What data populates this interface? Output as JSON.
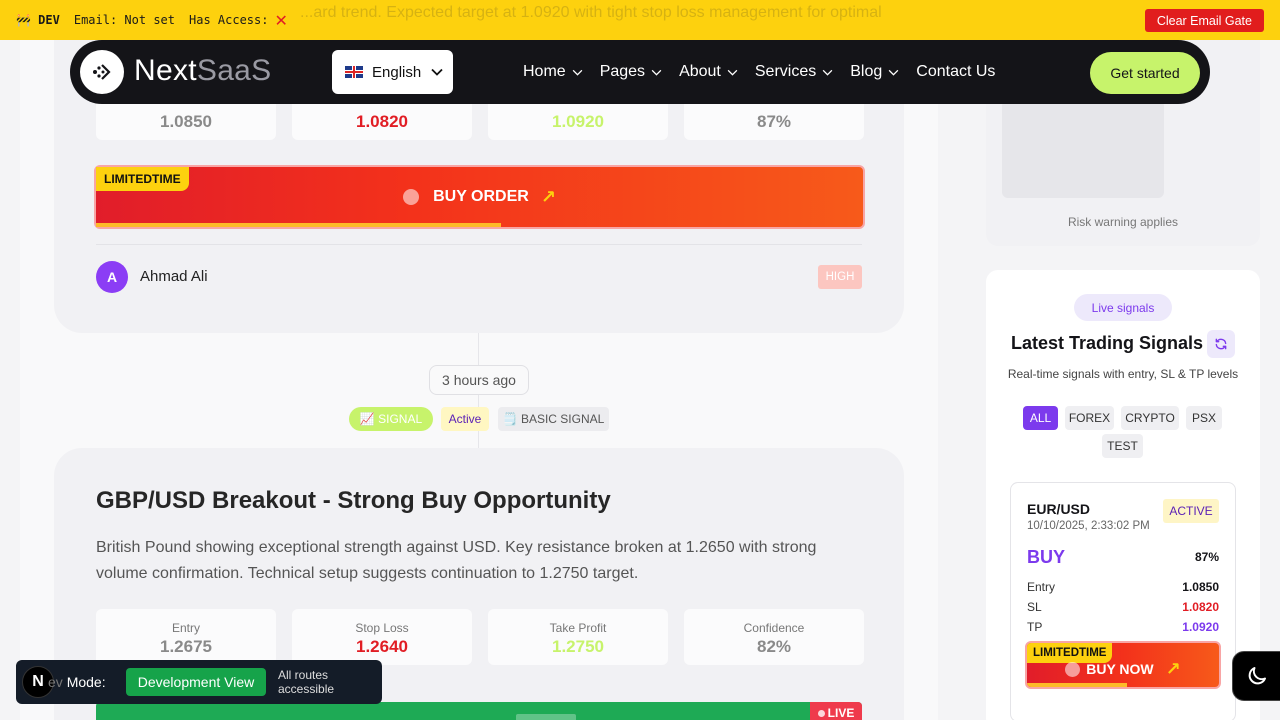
{
  "dev_banner": {
    "tag": "🚧 DEV",
    "email": "Email: Not set",
    "access": "Has Access:",
    "access_icon": "✕",
    "ghost_text": "...ard trend. Expected target at 1.0920 with tight stop loss management for optimal",
    "clear_button": "Clear Email Gate"
  },
  "nav": {
    "logo_main": "Next",
    "logo_accent": "SaaS",
    "language": "English",
    "links": [
      "Home",
      "Pages",
      "About",
      "Services",
      "Blog",
      "Contact Us"
    ],
    "cta": "Get started"
  },
  "card1": {
    "stats": [
      {
        "value": "1.0850",
        "color": "#8a8a8a"
      },
      {
        "value": "1.0820",
        "color": "#e11d24"
      },
      {
        "value": "1.0920",
        "color": "#c7f36b"
      },
      {
        "value": "87%",
        "color": "#8a8a8a"
      }
    ],
    "badge": "LIMITEDTIME",
    "button": "BUY ORDER",
    "author_initial": "A",
    "author": "Ahmad Ali",
    "priority": "HIGH"
  },
  "timeline": {
    "time": "3 hours ago",
    "tag_signal": "📈 SIGNAL",
    "tag_status": "Active",
    "tag_type": "🗒️ BASIC SIGNAL"
  },
  "card2": {
    "title": "GBP/USD Breakout - Strong Buy Opportunity",
    "description": "British Pound showing exceptional strength against USD. Key resistance broken at 1.2650 with strong volume confirmation. Technical setup suggests continuation to 1.2750 target.",
    "stats": [
      {
        "label": "Entry",
        "value": "1.2675",
        "color": "#8a8a8a"
      },
      {
        "label": "Stop Loss",
        "value": "1.2640",
        "color": "#e11d24"
      },
      {
        "label": "Take Profit",
        "value": "1.2750",
        "color": "#c7f36b"
      },
      {
        "label": "Confidence",
        "value": "82%",
        "color": "#8a8a8a"
      }
    ],
    "live": "LIVE"
  },
  "dev_mode": {
    "initial": "N",
    "label": "Mode:",
    "label_prefix": "ev",
    "button": "Development View",
    "routes": "All routes accessible"
  },
  "sidebar": {
    "risk": "Risk warning applies",
    "live_signals": "Live signals",
    "title": "Latest Trading Signals",
    "subtitle": "Real-time signals with entry, SL & TP levels",
    "filters": [
      "ALL",
      "FOREX",
      "CRYPTO",
      "PSX",
      "TEST"
    ],
    "signal": {
      "pair": "EUR/USD",
      "date": "10/10/2025, 2:33:02 PM",
      "status": "ACTIVE",
      "direction": "BUY",
      "confidence": "87%",
      "rows": [
        {
          "k": "Entry",
          "v": "1.0850",
          "color": "#141418"
        },
        {
          "k": "SL",
          "v": "1.0820",
          "color": "#e11d24"
        },
        {
          "k": "TP",
          "v": "1.0920",
          "color": "#7c3aed"
        }
      ],
      "badge": "LIMITEDTIME",
      "button": "BUY NOW"
    }
  }
}
